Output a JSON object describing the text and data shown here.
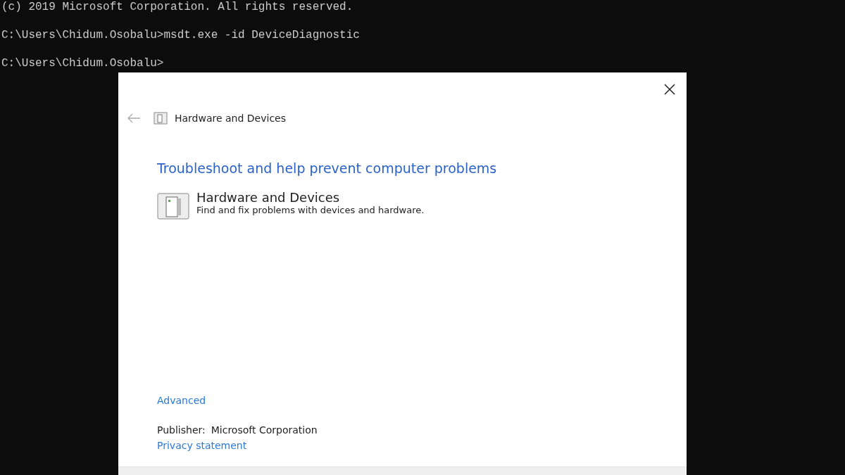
{
  "console": {
    "lines": [
      "(c) 2019 Microsoft Corporation. All rights reserved.",
      "C:\\Users\\Chidum.Osobalu>msdt.exe -id DeviceDiagnostic",
      "C:\\Users\\Chidum.Osobalu>"
    ]
  },
  "dialog": {
    "header_title": "Hardware and Devices",
    "heading": "Troubleshoot and help prevent computer problems",
    "troubleshooter": {
      "title": "Hardware and Devices",
      "description": "Find and fix problems with devices and hardware."
    },
    "advanced_link": "Advanced",
    "publisher_label": "Publisher:",
    "publisher": "Microsoft Corporation",
    "privacy_link": "Privacy statement"
  }
}
